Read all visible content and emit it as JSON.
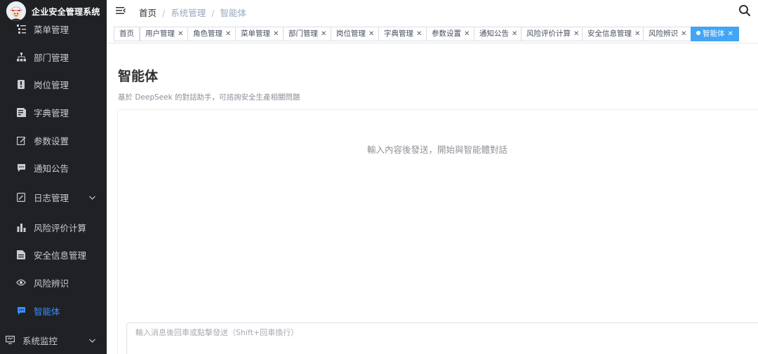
{
  "brand": {
    "title": "企业安全管理系统"
  },
  "sidebar": {
    "items": [
      {
        "label": "菜单管理",
        "icon": "tree-table-icon"
      },
      {
        "label": "部门管理",
        "icon": "tree-icon"
      },
      {
        "label": "岗位管理",
        "icon": "post-icon"
      },
      {
        "label": "字典管理",
        "icon": "dict-icon"
      },
      {
        "label": "参数设置",
        "icon": "edit-icon"
      },
      {
        "label": "通知公告",
        "icon": "message-icon"
      },
      {
        "label": "日志管理",
        "icon": "log-icon"
      },
      {
        "label": "风险评价计算",
        "icon": "chart-icon"
      },
      {
        "label": "安全信息管理",
        "icon": "document-icon"
      },
      {
        "label": "风险辨识",
        "icon": "eye-icon"
      },
      {
        "label": "智能体",
        "icon": "chat-icon",
        "active": true
      },
      {
        "label": "系统监控",
        "icon": "monitor-icon"
      }
    ]
  },
  "header": {
    "breadcrumb": [
      "首页",
      "系统管理",
      "智能体"
    ]
  },
  "tags": [
    {
      "label": "首页",
      "closable": false
    },
    {
      "label": "用户管理",
      "closable": true
    },
    {
      "label": "角色管理",
      "closable": true
    },
    {
      "label": "菜单管理",
      "closable": true
    },
    {
      "label": "部门管理",
      "closable": true
    },
    {
      "label": "岗位管理",
      "closable": true
    },
    {
      "label": "字典管理",
      "closable": true
    },
    {
      "label": "参数设置",
      "closable": true
    },
    {
      "label": "通知公告",
      "closable": true
    },
    {
      "label": "风险评价计算",
      "closable": true
    },
    {
      "label": "安全信息管理",
      "closable": true
    },
    {
      "label": "风险辨识",
      "closable": true
    },
    {
      "label": "智能体",
      "closable": true,
      "active": true
    }
  ],
  "main": {
    "title": "智能体",
    "subtitle": "基於 DeepSeek 的對話助手，可諮詢安全生產相關問題",
    "empty_hint": "輸入內容後發送，開始與智能體對話",
    "input_placeholder": "輸入消息後回車或點擊發送（Shift+回車換行）"
  },
  "colors": {
    "sidebar_bg": "#1f2125",
    "accent": "#3a8ef6",
    "active_tag": "#42a5f5"
  }
}
